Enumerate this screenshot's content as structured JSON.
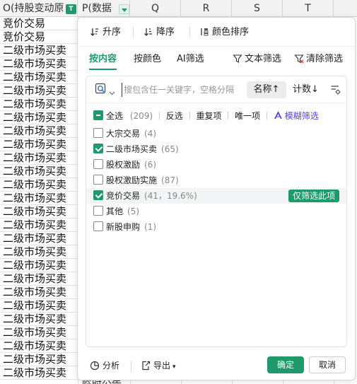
{
  "columns": {
    "o_header": "O(持股变动原",
    "o_filter_icon": "T",
    "p_header": "P(数据",
    "q": "Q",
    "r": "R",
    "s": "S",
    "t": "T"
  },
  "cells": [
    "竞价交易",
    "竞价交易",
    "二级市场买卖",
    "二级市场买卖",
    "二级市场买卖",
    "二级市场买卖",
    "二级市场买卖",
    "二级市场买卖",
    "二级市场买卖",
    "二级市场买卖",
    "二级市场买卖",
    "二级市场买卖",
    "二级市场买卖",
    "二级市场买卖",
    "二级市场买卖",
    "二级市场买卖",
    "二级市场买卖",
    "二级市场买卖",
    "二级市场买卖",
    "二级市场买卖",
    "二级市场买卖",
    "二级市场买卖",
    "二级市场买卖",
    "二级市场买卖",
    "二级市场买卖",
    "二级市场买卖",
    "二级市场买卖"
  ],
  "p_bottom_text": "临时公告",
  "toolbar": {
    "sort_asc": "升序",
    "sort_desc": "降序",
    "sort_color": "颜色排序"
  },
  "tabs": {
    "by_content": "按内容",
    "by_color": "按颜色",
    "ai_filter": "AI筛选",
    "text_filter": "文本筛选",
    "clear_filter": "清除筛选"
  },
  "search": {
    "placeholder": "搜包含任一关键字，空格分隔",
    "sort_name": "名称",
    "sort_name_arrow": "↑",
    "sort_count": "计数",
    "sort_count_arrow": "↓"
  },
  "actions": {
    "select_all": "全选",
    "select_all_count": "(209)",
    "invert": "反选",
    "duplicates": "重复项",
    "unique": "唯一项",
    "fuzzy": "模糊筛选"
  },
  "items": [
    {
      "label": "大宗交易",
      "count": "(4)",
      "checked": false
    },
    {
      "label": "二级市场买卖",
      "count": "(65)",
      "checked": true
    },
    {
      "label": "股权激励",
      "count": "(6)",
      "checked": false
    },
    {
      "label": "股权激励实施",
      "count": "(87)",
      "checked": false
    },
    {
      "label": "竞价交易",
      "count": "(41，19.6%)",
      "checked": true
    },
    {
      "label": "其他",
      "count": "(5)",
      "checked": false
    },
    {
      "label": "新股申购",
      "count": "(1)",
      "checked": false
    }
  ],
  "only_filter_label": "仅筛选此项",
  "footer": {
    "analyze": "分析",
    "export": "导出",
    "ok": "确定",
    "cancel": "取消"
  },
  "colors": {
    "accent": "#1f9a6a",
    "fuzzy": "#5b3fd6"
  }
}
